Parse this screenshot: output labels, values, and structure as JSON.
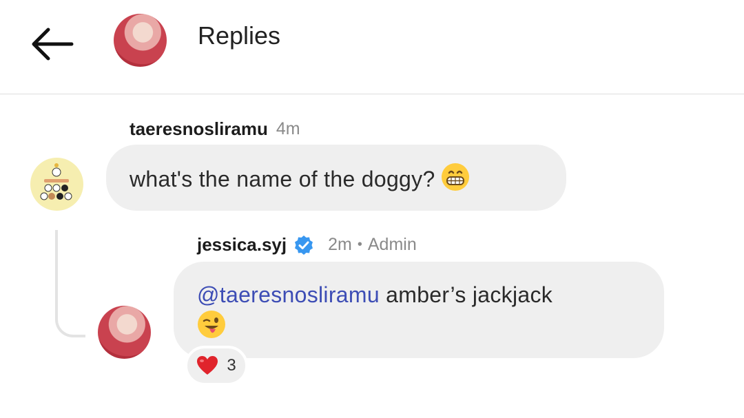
{
  "header": {
    "title": "Replies",
    "back_icon": "arrow-left-icon"
  },
  "comment": {
    "username": "taeresnosliramu",
    "time": "4m",
    "text": "what's the name of the doggy?",
    "emoji": "grinning-face-icon"
  },
  "reply": {
    "username": "jessica.syj",
    "verified_icon": "verified-badge-icon",
    "time": "2m",
    "separator": "•",
    "role": "Admin",
    "mention": "@taeresnosliramu",
    "text": " amber’s jackjack",
    "emoji": "winking-tongue-face-icon"
  },
  "reaction": {
    "icon": "red-heart-icon",
    "count": "3"
  },
  "colors": {
    "mention": "#3d4db5",
    "verified": "#3897f0",
    "bubble": "#efefef"
  }
}
